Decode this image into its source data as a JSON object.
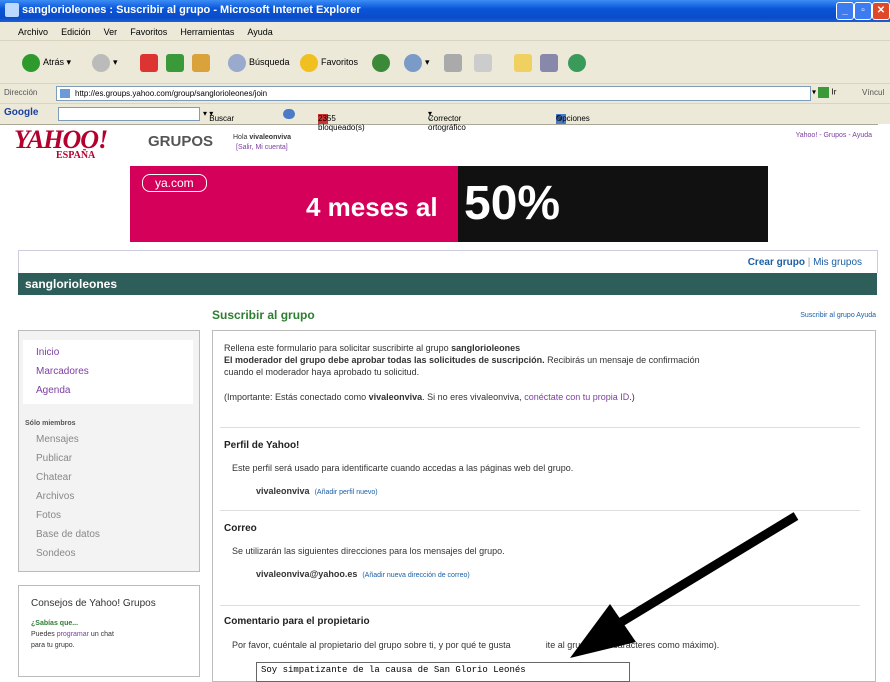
{
  "window": {
    "title": "sanglorioleones : Suscribir al grupo - Microsoft Internet Explorer"
  },
  "menu": [
    "Archivo",
    "Edición",
    "Ver",
    "Favoritos",
    "Herramientas",
    "Ayuda"
  ],
  "toolbar": {
    "back": "Atrás",
    "search": "Búsqueda",
    "favorites": "Favoritos"
  },
  "address": {
    "label": "Dirección",
    "url": "http://es.groups.yahoo.com/group/sanglorioleones/join",
    "go": "Ir",
    "links": "Víncul"
  },
  "google_bar": {
    "logo": "Google",
    "search": "Buscar",
    "blocked": "2355 bloqueado(s)",
    "spell": "Corrector ortográfico",
    "options": "Opciones"
  },
  "header": {
    "logo": "YAHOO!",
    "logo_sub": "ESPAÑA",
    "section": "GRUPOS",
    "greeting_prefix": "Hola ",
    "user": "vivaleonviva",
    "signout": "[Salir, Mi cuenta]",
    "top_links": "Yahoo! - Grupos - Ayuda"
  },
  "banner": {
    "brand": "ya.com",
    "text1": "4 meses al",
    "text2": "50%"
  },
  "group": {
    "crear": "Crear grupo",
    "sep": " | ",
    "mis": "Mis grupos",
    "name": "sanglorioleones"
  },
  "nav": {
    "top_links": [
      "Inicio",
      "Marcadores",
      "Agenda"
    ],
    "members_label": "Sólo miembros",
    "member_links": [
      "Mensajes",
      "Publicar",
      "Chatear",
      "Archivos",
      "Fotos",
      "Base de datos",
      "Sondeos"
    ]
  },
  "tips": {
    "title": "Consejos de Yahoo! Grupos",
    "q": "¿Sabías que...",
    "line1_a": "Puedes ",
    "line1_link": "programar",
    "line1_b": " un chat",
    "line2": "para tu grupo."
  },
  "main": {
    "title": "Suscribir al grupo",
    "top_links": "Suscribir al grupo Ayuda",
    "intro_a": "Rellena este formulario para solicitar suscribirte al grupo ",
    "intro_group": "sanglorioleones",
    "intro_bold": "El moderador del grupo debe aprobar todas las solicitudes de suscripción.",
    "intro_b": " Recibirás un mensaje de confirmación",
    "intro_c": "cuando el moderador haya aprobado tu solicitud.",
    "important_a": "(Importante: Estás conectado como ",
    "important_user": "vivaleonviva",
    "important_b": ". Si no eres vivaleonviva, ",
    "important_link": "conéctate con tu propia ID",
    "important_c": ".)",
    "profile_head": "Perfil de Yahoo!",
    "profile_text": "Este perfil será usado para identificarte cuando accedas a las páginas web del grupo.",
    "profile_user": "vivaleonviva",
    "profile_add": "(Añadir perfil nuevo)",
    "email_head": "Correo",
    "email_text": "Se utilizarán las siguientes direcciones para los mensajes del grupo.",
    "email_addr": "vivaleonviva@yahoo.es",
    "email_add": "(Añadir nueva dirección de correo)",
    "comment_head": "Comentario para el propietario",
    "comment_text": "Por favor, cuéntale al propietario del grupo sobre ti, y por qué te gusta",
    "comment_text2": "ite al grupo (200 caracteres como máximo).",
    "comment_value": "Soy simpatizante de la causa de San Glorio Leonés"
  },
  "colors": {
    "yahoo_red": "#b3002d",
    "group_bar": "#2e5e5a",
    "link": "#1b5fa6",
    "visited": "#7b3fa0",
    "banner_pink": "#d4005a"
  }
}
